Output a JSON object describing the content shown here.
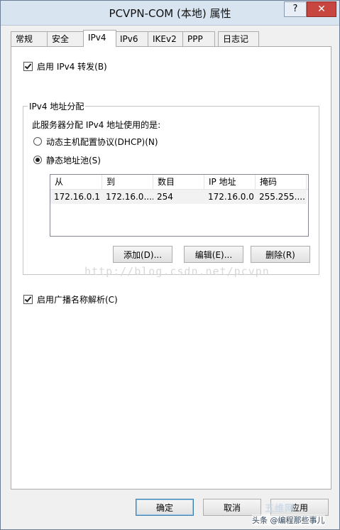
{
  "window": {
    "title": "PCVPN-COM (本地) 属性",
    "help_label": "?",
    "close_label": "✕"
  },
  "tabs": [
    {
      "label": "常规"
    },
    {
      "label": "安全"
    },
    {
      "label": "IPv4",
      "active": true
    },
    {
      "label": "IPv6"
    },
    {
      "label": "IKEv2"
    },
    {
      "label": "PPP"
    },
    {
      "label": "日志记录"
    }
  ],
  "ipv4": {
    "forwarding": {
      "label": "启用 IPv4 转发(B)",
      "checked": true
    },
    "assignment": {
      "group_label": "IPv4 地址分配",
      "description": "此服务器分配 IPv4 地址使用的是:",
      "dhcp": {
        "label": "动态主机配置协议(DHCP)(N)",
        "selected": false
      },
      "static_pool": {
        "label": "静态地址池(S)",
        "selected": true
      },
      "table": {
        "columns": [
          "从",
          "到",
          "数目",
          "IP 地址",
          "掩码"
        ],
        "rows": [
          [
            "172.16.0.1",
            "172.16.0....",
            "254",
            "172.16.0.0",
            "255.255...."
          ]
        ]
      },
      "buttons": {
        "add": "添加(D)...",
        "edit": "编辑(E)...",
        "delete": "删除(R)"
      }
    },
    "broadcast": {
      "label": "启用广播名称解析(C)",
      "checked": true
    }
  },
  "footer": {
    "ok": "确定",
    "cancel": "取消",
    "apply": "应用"
  },
  "overlays": {
    "watermark": "http://blog.csdn.net/pcvpn",
    "brand": "五维网",
    "credit": "头条 @编程那些事儿"
  }
}
